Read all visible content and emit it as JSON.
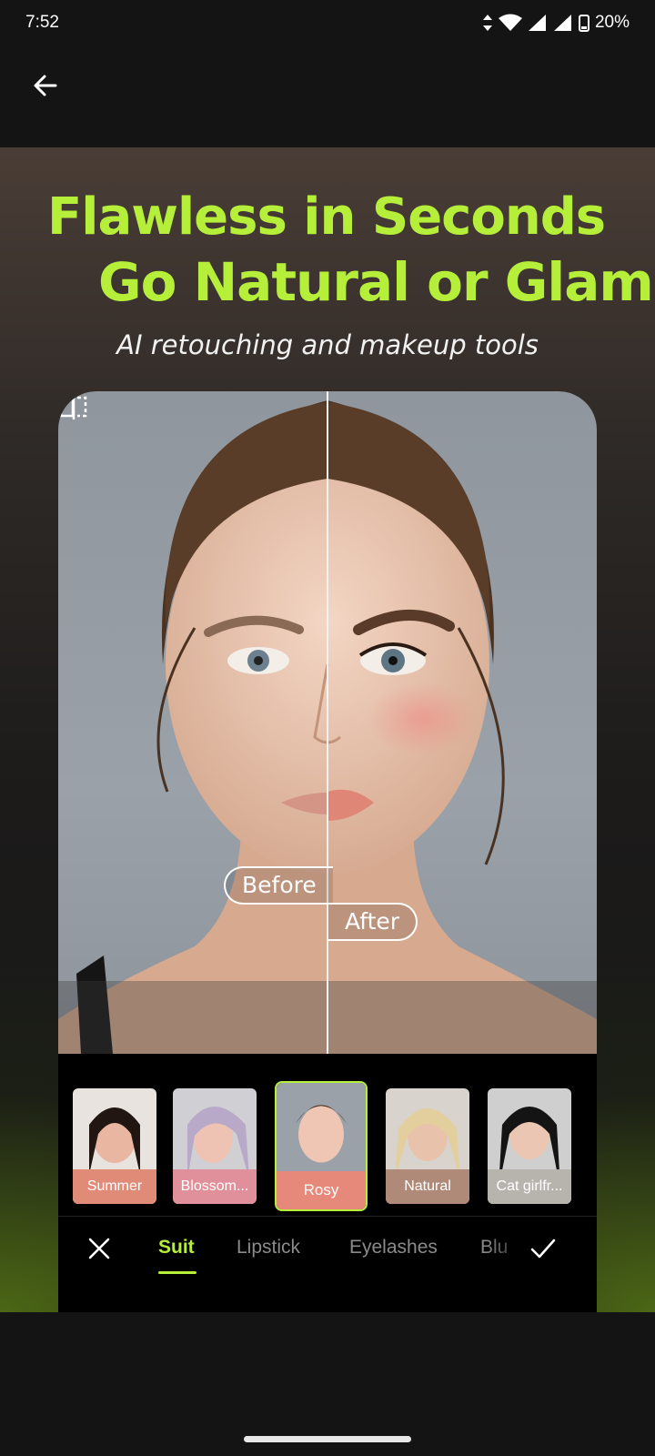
{
  "status_bar": {
    "time": "7:52",
    "battery": "20%"
  },
  "promo": {
    "headline_line1": "Flawless in Seconds",
    "headline_line2": "Go Natural or Glam!",
    "subheadline": "AI retouching and makeup tools"
  },
  "comparison": {
    "before_label": "Before",
    "after_label": "After"
  },
  "presets": [
    {
      "label": "Summer",
      "color": "#e08a78"
    },
    {
      "label": "Blossom...",
      "color": "#e0909a"
    },
    {
      "label": "Rosy",
      "color": "#e6897a",
      "selected": true
    },
    {
      "label": "Natural",
      "color": "#b08a78"
    },
    {
      "label": "Cat girlfr...",
      "color": "#b7b4ad"
    }
  ],
  "tabs": [
    {
      "label": "Suit",
      "active": true
    },
    {
      "label": "Lipstick"
    },
    {
      "label": "Eyelashes"
    },
    {
      "label": "Blu"
    }
  ],
  "colors": {
    "accent": "#b6ef3a",
    "background": "#141414"
  },
  "icons": [
    "back-arrow-icon",
    "compare-icon",
    "close-icon",
    "checkmark-icon"
  ]
}
